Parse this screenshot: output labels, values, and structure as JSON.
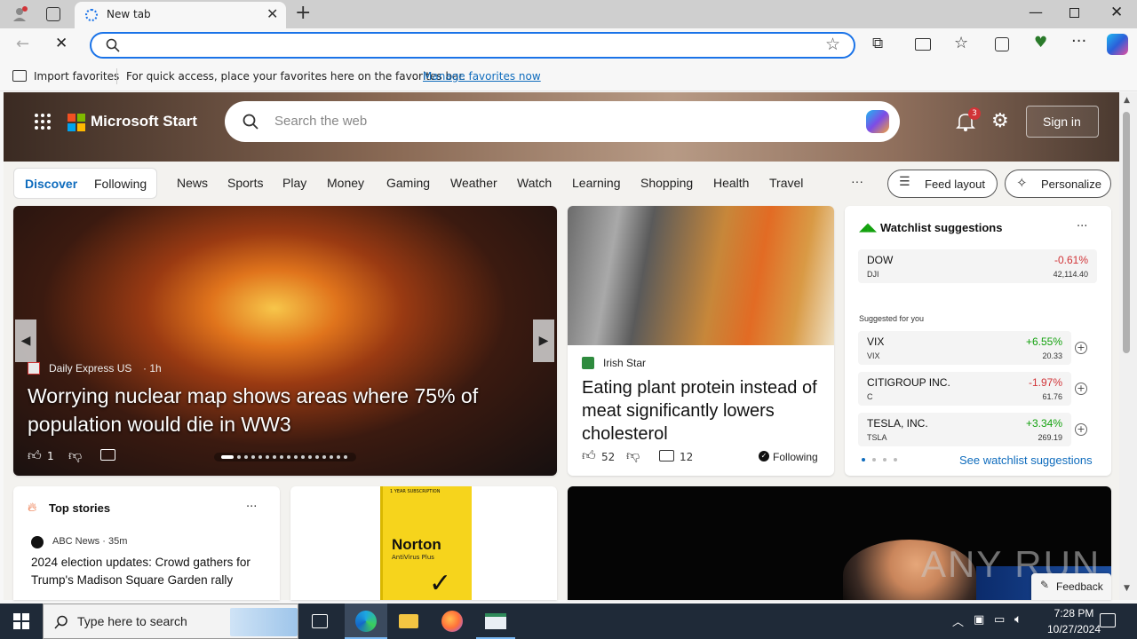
{
  "browser": {
    "tab_title": "New tab",
    "import_favorites": "Import favorites",
    "favorites_hint": "For quick access, place your favorites here on the favorites bar.",
    "manage_favorites": "Manage favorites now"
  },
  "header": {
    "brand": "Microsoft Start",
    "search_placeholder": "Search the web",
    "notification_count": "3",
    "sign_in": "Sign in"
  },
  "nav": {
    "discover": "Discover",
    "following": "Following",
    "items": [
      "News",
      "Sports",
      "Play",
      "Money",
      "Gaming",
      "Weather",
      "Watch",
      "Learning",
      "Shopping",
      "Health",
      "Travel"
    ],
    "more": "···",
    "feed_layout": "Feed layout",
    "personalize": "Personalize"
  },
  "hero": {
    "source": "Daily Express US",
    "age": "· 1h",
    "headline": "Worrying nuclear map shows areas where 75% of population would die in WW3",
    "likes": "1"
  },
  "story2": {
    "source": "Irish Star",
    "headline": "Eating plant protein instead of meat significantly lowers cholesterol",
    "likes": "52",
    "comments": "12",
    "following": "Following"
  },
  "watchlist": {
    "title": "Watchlist suggestions",
    "more": "···",
    "suggested_label": "Suggested for you",
    "see_more": "See watchlist suggestions",
    "stocks": [
      {
        "name": "DOW",
        "symbol": "DJI",
        "change": "-0.61%",
        "price": "42,114.40",
        "up": false
      },
      {
        "name": "VIX",
        "symbol": "VIX",
        "change": "+6.55%",
        "price": "20.33",
        "up": true
      },
      {
        "name": "CITIGROUP INC.",
        "symbol": "C",
        "change": "-1.97%",
        "price": "61.76",
        "up": false
      },
      {
        "name": "TESLA, INC.",
        "symbol": "TSLA",
        "change": "+3.34%",
        "price": "269.19",
        "up": true
      }
    ]
  },
  "top_stories": {
    "title": "Top stories",
    "more": "···",
    "source": "ABC News · 35m",
    "headline": "2024 election updates: Crowd gathers for Trump's Madison Square Garden rally"
  },
  "ad": {
    "brand": "Norton",
    "product": "AntiVirus Plus",
    "tag": "1 YEAR SUBSCRIPTION"
  },
  "feedback": "Feedback",
  "watermark": "ANY RUN",
  "taskbar": {
    "search_placeholder": "Type here to search",
    "time": "7:28 PM",
    "date": "10/27/2024"
  },
  "colors": {
    "accent": "#0f6cbd",
    "up": "#13a10e",
    "down": "#d13438"
  }
}
